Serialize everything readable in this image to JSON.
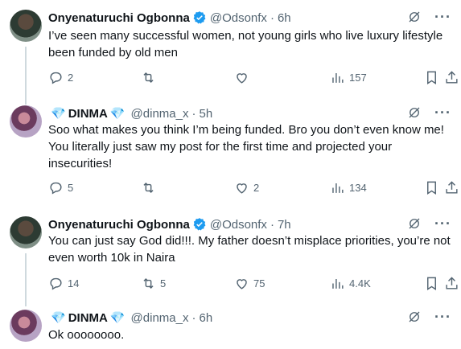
{
  "tweets": [
    {
      "avatar": "man-avatar",
      "name": "Onyenaturuchi Ogbonna",
      "verified": true,
      "name_emoji": false,
      "handle": "@Odsonfx",
      "time": "6h",
      "text_lines": [
        "I’ve seen many successful women, not young girls who live luxury lifestyle",
        "been funded by old men"
      ],
      "replies": "2",
      "retweets": "",
      "likes": "",
      "views": "157"
    },
    {
      "avatar": "woman-avatar",
      "name": "DINMA",
      "verified": false,
      "name_emoji": "💎",
      "handle": "@dinma_x",
      "time": "5h",
      "text_lines": [
        "Soo what makes you think I’m being funded. Bro you don’t even know me!",
        "You literally just saw my post for the first time and projected your",
        "insecurities!"
      ],
      "replies": "5",
      "retweets": "",
      "likes": "2",
      "views": "134"
    },
    {
      "avatar": "man-avatar",
      "name": "Onyenaturuchi Ogbonna",
      "verified": true,
      "name_emoji": false,
      "handle": "@Odsonfx",
      "time": "7h",
      "text_lines": [
        "You can just say God did!!!. My father doesn’t misplace priorities, you’re not",
        "even worth 10k in Naira"
      ],
      "replies": "14",
      "retweets": "5",
      "likes": "75",
      "views": "4.4K"
    },
    {
      "avatar": "woman-avatar",
      "name": "DINMA",
      "verified": false,
      "name_emoji": "💎",
      "handle": "@dinma_x",
      "time": "6h",
      "text_lines": [
        "Ok oooooooo."
      ],
      "replies": "",
      "retweets": "",
      "likes": "",
      "views": ""
    }
  ],
  "dot": "·",
  "more": "···",
  "colors": {
    "verified_blue": "#1d9bf0",
    "muted": "#536471",
    "text": "#0f1419",
    "thread_line": "#cfd9de"
  }
}
